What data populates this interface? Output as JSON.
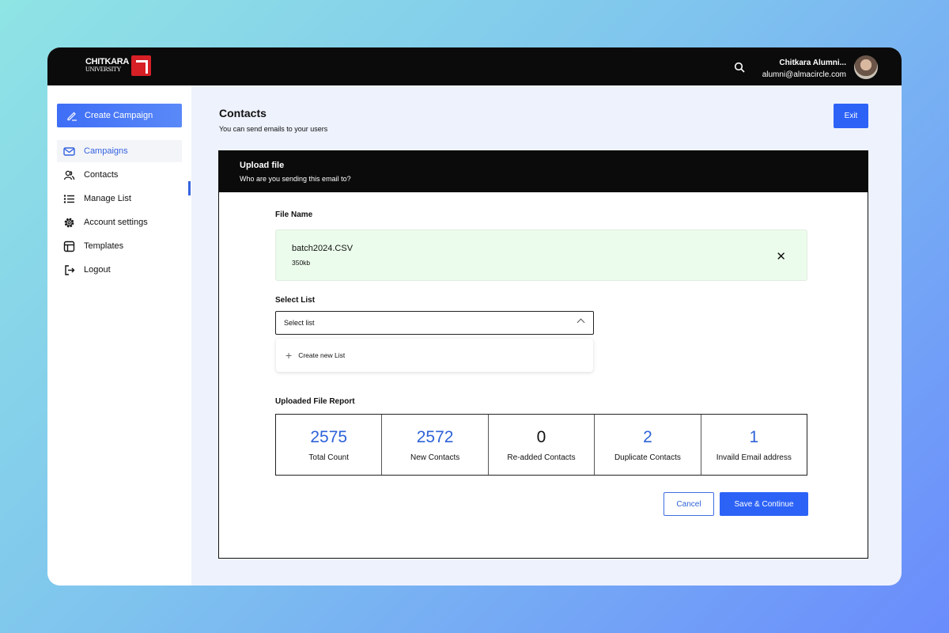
{
  "brand": {
    "name": "CHITKARA",
    "sub": "UNIVERSITY"
  },
  "user": {
    "name": "Chitkara Alumni...",
    "email": "alumni@almacircle.com"
  },
  "sidebar": {
    "create": "Create Campaign",
    "items": [
      {
        "label": "Campaigns",
        "icon": "mail-icon"
      },
      {
        "label": "Contacts",
        "icon": "users-icon"
      },
      {
        "label": "Manage List",
        "icon": "list-icon"
      },
      {
        "label": "Account settings",
        "icon": "gear-icon"
      },
      {
        "label": "Templates",
        "icon": "layout-icon"
      },
      {
        "label": "Logout",
        "icon": "logout-icon"
      }
    ]
  },
  "page": {
    "title": "Contacts",
    "subtitle": "You can send emails to your users",
    "exit": "Exit"
  },
  "card": {
    "title": "Upload file",
    "subtitle": "Who are you sending this email to?",
    "file_label": "File Name",
    "file": {
      "name": "batch2024.CSV",
      "size": "350kb"
    },
    "select_label": "Select List",
    "select_placeholder": "Select list",
    "dropdown_option": "Create new List",
    "report_label": "Uploaded File Report",
    "stats": [
      {
        "value": "2575",
        "label": "Total Count"
      },
      {
        "value": "2572",
        "label": "New Contacts"
      },
      {
        "value": "0",
        "label": "Re-added Contacts"
      },
      {
        "value": "2",
        "label": "Duplicate Contacts"
      },
      {
        "value": "1",
        "label": "Invaild Email address"
      }
    ],
    "cancel": "Cancel",
    "save": "Save & Continue"
  },
  "colors": {
    "accent": "#2c62f6",
    "file_bg": "#ecfcec",
    "header": "#0b0b0b"
  }
}
